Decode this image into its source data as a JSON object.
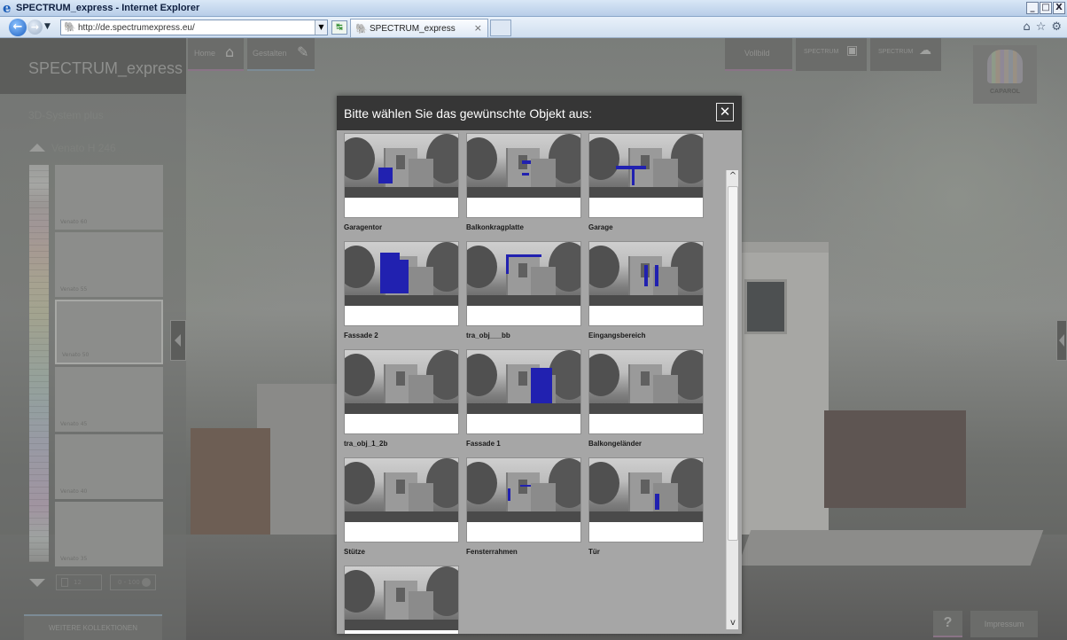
{
  "browser": {
    "window_title": "SPECTRUM_express - Internet Explorer",
    "url": "http://de.spectrumexpress.eu/",
    "tab_title": "SPECTRUM_express",
    "window_buttons": [
      "_",
      "□",
      "X"
    ]
  },
  "app": {
    "logo": "SPECTRUM_express",
    "nav": {
      "home": "Home",
      "gestalten": "Gestalten",
      "vollbild": "Vollbild",
      "spectrum1": "SPECTRUM",
      "spectrum2": "SPECTRUM"
    },
    "brand": "CAPAROL",
    "help": "?",
    "impressum": "Impressum"
  },
  "sidebar": {
    "system": "3D-System plus",
    "collection": "Venato H 246",
    "swatches": [
      {
        "label": "Venato 60",
        "selected": false
      },
      {
        "label": "Venato 55",
        "selected": false
      },
      {
        "label": "Venato 50",
        "selected": true
      },
      {
        "label": "Venato 45",
        "selected": false
      },
      {
        "label": "Venato 40",
        "selected": false
      },
      {
        "label": "Venato 35",
        "selected": false
      }
    ],
    "page_value": "12",
    "range_value": "0 - 100",
    "more_collections": "WEITERE KOLLEKTIONEN"
  },
  "modal": {
    "title": "Bitte wählen Sie das gewünschte Objekt aus:",
    "close": "✕",
    "objects": [
      {
        "label": "Garagentor",
        "highlight": "garagentor"
      },
      {
        "label": "Balkonkragplatte",
        "highlight": "balkon"
      },
      {
        "label": "Garage",
        "highlight": "garage"
      },
      {
        "label": "Fassade 2",
        "highlight": "fassade2"
      },
      {
        "label": "tra_obj___bb",
        "highlight": "bb"
      },
      {
        "label": "Eingangsbereich",
        "highlight": "eingang"
      },
      {
        "label": "tra_obj_1_2b",
        "highlight": "none"
      },
      {
        "label": "Fassade 1",
        "highlight": "fassade1"
      },
      {
        "label": "Balkongeländer",
        "highlight": "none"
      },
      {
        "label": "Stütze",
        "highlight": "none"
      },
      {
        "label": "Fensterrahmen",
        "highlight": "fenster"
      },
      {
        "label": "Tür",
        "highlight": "tuer"
      },
      {
        "label": "",
        "highlight": "none"
      }
    ],
    "highlight_color": "#2121b0"
  }
}
